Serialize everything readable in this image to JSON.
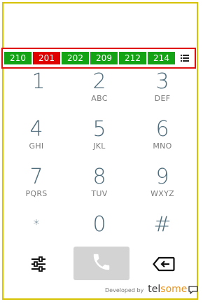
{
  "status_bar": {
    "chips": [
      {
        "label": "210",
        "color": "#14a314"
      },
      {
        "label": "201",
        "color": "#e00000"
      },
      {
        "label": "202",
        "color": "#14a314"
      },
      {
        "label": "209",
        "color": "#14a314"
      },
      {
        "label": "212",
        "color": "#14a314"
      },
      {
        "label": "214",
        "color": "#14a314"
      }
    ],
    "list_icon": "list-icon"
  },
  "keypad": {
    "keys": [
      {
        "digit": "1",
        "letters": ""
      },
      {
        "digit": "2",
        "letters": "ABC"
      },
      {
        "digit": "3",
        "letters": "DEF"
      },
      {
        "digit": "4",
        "letters": "GHI"
      },
      {
        "digit": "5",
        "letters": "JKL"
      },
      {
        "digit": "6",
        "letters": "MNO"
      },
      {
        "digit": "7",
        "letters": "PQRS"
      },
      {
        "digit": "8",
        "letters": "TUV"
      },
      {
        "digit": "9",
        "letters": "WXYZ"
      },
      {
        "digit": "*",
        "letters": ""
      },
      {
        "digit": "0",
        "letters": ""
      },
      {
        "digit": "#",
        "letters": ""
      }
    ]
  },
  "actions": {
    "settings_icon": "sliders-icon",
    "call_icon": "phone-icon",
    "backspace_icon": "backspace-icon"
  },
  "footer": {
    "developed_by": "Developed by",
    "brand_part1": "tel",
    "brand_part2": "some"
  },
  "colors": {
    "frame": "#d6c200",
    "highlight": "#e01010",
    "chip_green": "#14a314",
    "chip_red": "#e00000",
    "digit": "#4d6b7a",
    "call_button": "#d3d3d3",
    "brand_accent": "#e8941a"
  }
}
